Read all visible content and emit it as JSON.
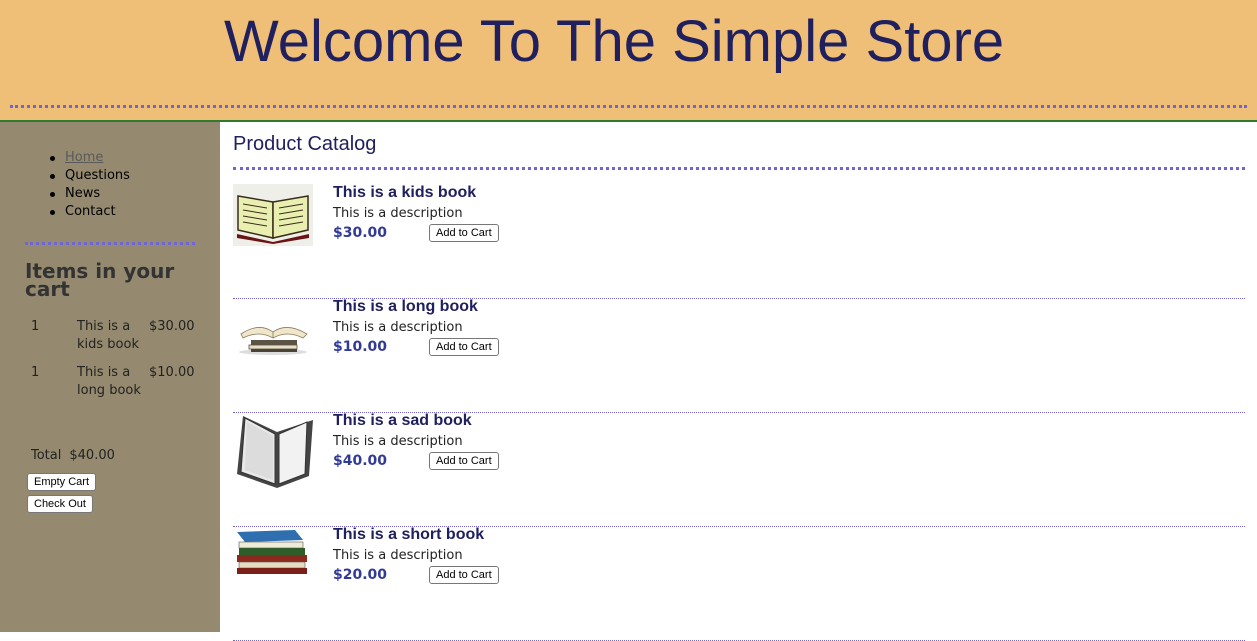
{
  "header": {
    "title": "Welcome To The Simple Store"
  },
  "nav": {
    "items": [
      {
        "label": "Home",
        "current": true
      },
      {
        "label": "Questions"
      },
      {
        "label": "News"
      },
      {
        "label": "Contact"
      }
    ]
  },
  "cart": {
    "heading": "Items in your cart",
    "items": [
      {
        "qty": "1",
        "name": "This is a kids book",
        "price": "$30.00"
      },
      {
        "qty": "1",
        "name": "This is a long book",
        "price": "$10.00"
      }
    ],
    "total_label": "Total",
    "total_value": "$40.00",
    "empty_label": "Empty Cart",
    "checkout_label": "Check Out"
  },
  "catalog": {
    "title": "Product Catalog",
    "add_label": "Add to Cart",
    "products": [
      {
        "title": "This is a kids book",
        "description": "This is a description",
        "price": "$30.00",
        "icon": "open-book-icon"
      },
      {
        "title": "This is a long book",
        "description": "This is a description",
        "price": "$10.00",
        "icon": "book-on-stack-icon"
      },
      {
        "title": "This is a sad book",
        "description": "This is a description",
        "price": "$40.00",
        "icon": "white-open-book-icon"
      },
      {
        "title": "This is a short book",
        "description": "This is a description",
        "price": "$20.00",
        "icon": "book-stack-icon"
      }
    ]
  },
  "colors": {
    "banner": "#efbf77",
    "sidebar": "#958a6f",
    "heading": "#21205f",
    "price": "#323a98",
    "dotted_rule": "#6f64d8"
  }
}
